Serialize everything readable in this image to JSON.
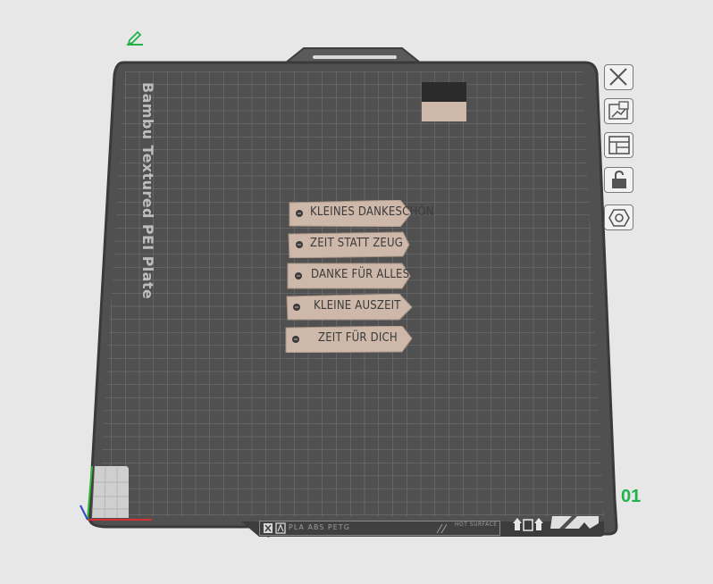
{
  "plate": {
    "name_label": "Bambu Textured PEI Plate",
    "plate_number": "01",
    "filament_text": "PLA ABS PETG",
    "hot_surface_text": "HOT SURFACE"
  },
  "tags": [
    {
      "text": "KLEINES DANKESCHÖN"
    },
    {
      "text": "ZEIT STATT ZEUG"
    },
    {
      "text": "DANKE FÜR ALLES"
    },
    {
      "text": "KLEINE AUSZEIT"
    },
    {
      "text": "ZEIT FÜR DICH"
    }
  ],
  "toolbar": {
    "buttons": [
      {
        "name": "close-plate-button",
        "icon": "close-icon"
      },
      {
        "name": "auto-arrange-button",
        "icon": "arrange-icon"
      },
      {
        "name": "plate-layout-button",
        "icon": "layout-icon"
      },
      {
        "name": "lock-plate-button",
        "icon": "lock-icon"
      },
      {
        "name": "plate-settings-button",
        "icon": "hex-nut-icon"
      }
    ]
  },
  "colors": {
    "plate": "#4f504f",
    "grid": "#7d7e7d",
    "tag_fill": "#cdb8aa",
    "accent_green": "#22b24c",
    "background": "#e7e7e7"
  }
}
